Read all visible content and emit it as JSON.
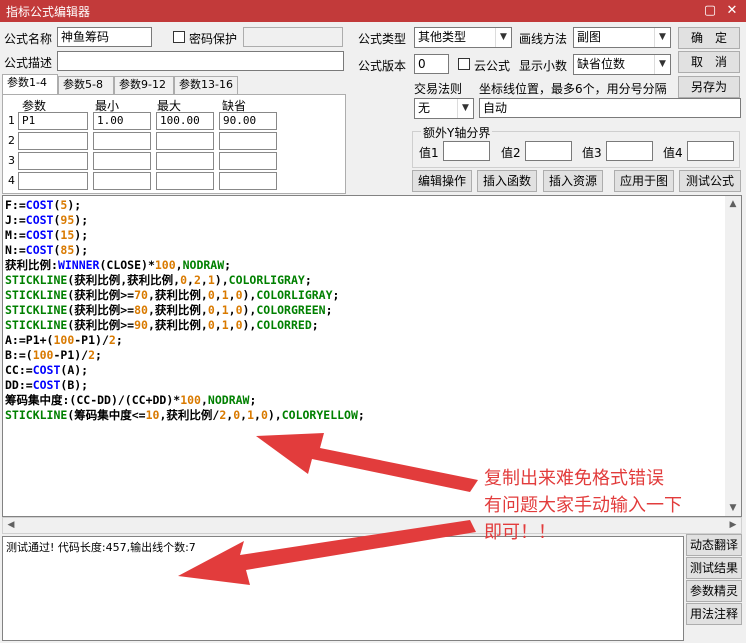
{
  "window": {
    "title": "指标公式编辑器",
    "close_glyph": "✕",
    "restore_glyph": "▢"
  },
  "form": {
    "name_label": "公式名称",
    "name_value": "神鱼筹码",
    "password_label": "密码保护",
    "password_value": "",
    "desc_label": "公式描述",
    "desc_value": "",
    "type_label": "公式类型",
    "type_value": "其他类型",
    "draw_label": "画线方法",
    "draw_value": "副图",
    "version_label": "公式版本",
    "version_value": "0",
    "cloud_label": "云公式",
    "decimal_label": "显示小数",
    "decimal_value": "缺省位数",
    "trade_label": "交易法则",
    "trade_value": "无",
    "coord_label": "坐标线位置，最多6个，用分号分隔",
    "coord_value": "自动",
    "yaxis_title": "额外Y轴分界",
    "yaxis_values": [
      {
        "label": "值1",
        "value": ""
      },
      {
        "label": "值2",
        "value": ""
      },
      {
        "label": "值3",
        "value": ""
      },
      {
        "label": "值4",
        "value": ""
      }
    ]
  },
  "buttons": {
    "ok": "确　定",
    "cancel": "取　消",
    "save_as": "另存为",
    "edit_ops": "编辑操作",
    "insert_func": "插入函数",
    "insert_res": "插入资源",
    "apply_chart": "应用于图",
    "test_formula": "测试公式",
    "dyn_translate": "动态翻译",
    "test_result": "测试结果",
    "param_tune": "参数精灵",
    "usage_note": "用法注释"
  },
  "tabs": [
    "参数1-4",
    "参数5-8",
    "参数9-12",
    "参数13-16"
  ],
  "params": {
    "headers": [
      "参数",
      "最小",
      "最大",
      "缺省"
    ],
    "rows": [
      {
        "num": "1",
        "cells": [
          "P1",
          "1.00",
          "100.00",
          "90.00"
        ]
      },
      {
        "num": "2",
        "cells": [
          "",
          "",
          "",
          ""
        ]
      },
      {
        "num": "3",
        "cells": [
          "",
          "",
          "",
          ""
        ]
      },
      {
        "num": "4",
        "cells": [
          "",
          "",
          "",
          ""
        ]
      }
    ]
  },
  "colors": {
    "titlebar": "#c23a3a",
    "code_ident": "#000000",
    "code_func": "#0000ff",
    "code_number": "#d97a00",
    "code_color": "#008000",
    "code_keyword": "#008000",
    "annotation": "#e23c3c"
  },
  "code_lines": [
    [
      {
        "t": "F:=",
        "c": "ident"
      },
      {
        "t": "COST",
        "c": "func"
      },
      {
        "t": "(",
        "c": "ident"
      },
      {
        "t": "5",
        "c": "number"
      },
      {
        "t": ");",
        "c": "ident"
      }
    ],
    [
      {
        "t": "J:=",
        "c": "ident"
      },
      {
        "t": "COST",
        "c": "func"
      },
      {
        "t": "(",
        "c": "ident"
      },
      {
        "t": "95",
        "c": "number"
      },
      {
        "t": ");",
        "c": "ident"
      }
    ],
    [
      {
        "t": "M:=",
        "c": "ident"
      },
      {
        "t": "COST",
        "c": "func"
      },
      {
        "t": "(",
        "c": "ident"
      },
      {
        "t": "15",
        "c": "number"
      },
      {
        "t": ");",
        "c": "ident"
      }
    ],
    [
      {
        "t": "N:=",
        "c": "ident"
      },
      {
        "t": "COST",
        "c": "func"
      },
      {
        "t": "(",
        "c": "ident"
      },
      {
        "t": "85",
        "c": "number"
      },
      {
        "t": ");",
        "c": "ident"
      }
    ],
    [
      {
        "t": "获利比例:",
        "c": "ident"
      },
      {
        "t": "WINNER",
        "c": "func"
      },
      {
        "t": "(CLOSE)*",
        "c": "ident"
      },
      {
        "t": "100",
        "c": "number"
      },
      {
        "t": ",",
        "c": "ident"
      },
      {
        "t": "NODRAW",
        "c": "keyword"
      },
      {
        "t": ";",
        "c": "ident"
      }
    ],
    [
      {
        "t": "STICKLINE",
        "c": "keyword"
      },
      {
        "t": "(获利比例,获利比例,",
        "c": "ident"
      },
      {
        "t": "0",
        "c": "number"
      },
      {
        "t": ",",
        "c": "ident"
      },
      {
        "t": "2",
        "c": "number"
      },
      {
        "t": ",",
        "c": "ident"
      },
      {
        "t": "1",
        "c": "number"
      },
      {
        "t": "),",
        "c": "ident"
      },
      {
        "t": "COLORLIGRAY",
        "c": "color"
      },
      {
        "t": ";",
        "c": "ident"
      }
    ],
    [
      {
        "t": "STICKLINE",
        "c": "keyword"
      },
      {
        "t": "(获利比例>=",
        "c": "ident"
      },
      {
        "t": "70",
        "c": "number"
      },
      {
        "t": ",获利比例,",
        "c": "ident"
      },
      {
        "t": "0",
        "c": "number"
      },
      {
        "t": ",",
        "c": "ident"
      },
      {
        "t": "1",
        "c": "number"
      },
      {
        "t": ",",
        "c": "ident"
      },
      {
        "t": "0",
        "c": "number"
      },
      {
        "t": "),",
        "c": "ident"
      },
      {
        "t": "COLORLIGRAY",
        "c": "color"
      },
      {
        "t": ";",
        "c": "ident"
      }
    ],
    [
      {
        "t": "STICKLINE",
        "c": "keyword"
      },
      {
        "t": "(获利比例>=",
        "c": "ident"
      },
      {
        "t": "80",
        "c": "number"
      },
      {
        "t": ",获利比例,",
        "c": "ident"
      },
      {
        "t": "0",
        "c": "number"
      },
      {
        "t": ",",
        "c": "ident"
      },
      {
        "t": "1",
        "c": "number"
      },
      {
        "t": ",",
        "c": "ident"
      },
      {
        "t": "0",
        "c": "number"
      },
      {
        "t": "),",
        "c": "ident"
      },
      {
        "t": "COLORGREEN",
        "c": "color"
      },
      {
        "t": ";",
        "c": "ident"
      }
    ],
    [
      {
        "t": "STICKLINE",
        "c": "keyword"
      },
      {
        "t": "(获利比例>=",
        "c": "ident"
      },
      {
        "t": "90",
        "c": "number"
      },
      {
        "t": ",获利比例,",
        "c": "ident"
      },
      {
        "t": "0",
        "c": "number"
      },
      {
        "t": ",",
        "c": "ident"
      },
      {
        "t": "1",
        "c": "number"
      },
      {
        "t": ",",
        "c": "ident"
      },
      {
        "t": "0",
        "c": "number"
      },
      {
        "t": "),",
        "c": "ident"
      },
      {
        "t": "COLORRED",
        "c": "color"
      },
      {
        "t": ";",
        "c": "ident"
      }
    ],
    [
      {
        "t": "A:=P1+(",
        "c": "ident"
      },
      {
        "t": "100",
        "c": "number"
      },
      {
        "t": "-P1)/",
        "c": "ident"
      },
      {
        "t": "2",
        "c": "number"
      },
      {
        "t": ";",
        "c": "ident"
      }
    ],
    [
      {
        "t": "B:=(",
        "c": "ident"
      },
      {
        "t": "100",
        "c": "number"
      },
      {
        "t": "-P1)/",
        "c": "ident"
      },
      {
        "t": "2",
        "c": "number"
      },
      {
        "t": ";",
        "c": "ident"
      }
    ],
    [
      {
        "t": "CC:=",
        "c": "ident"
      },
      {
        "t": "COST",
        "c": "func"
      },
      {
        "t": "(A);",
        "c": "ident"
      }
    ],
    [
      {
        "t": "DD:=",
        "c": "ident"
      },
      {
        "t": "COST",
        "c": "func"
      },
      {
        "t": "(B);",
        "c": "ident"
      }
    ],
    [
      {
        "t": "筹码集中度:(CC-DD)/(CC+DD)*",
        "c": "ident"
      },
      {
        "t": "100",
        "c": "number"
      },
      {
        "t": ",",
        "c": "ident"
      },
      {
        "t": "NODRAW",
        "c": "keyword"
      },
      {
        "t": ";",
        "c": "ident"
      }
    ],
    [
      {
        "t": "STICKLINE",
        "c": "keyword"
      },
      {
        "t": "(筹码集中度<=",
        "c": "ident"
      },
      {
        "t": "10",
        "c": "number"
      },
      {
        "t": ",获利比例/",
        "c": "ident"
      },
      {
        "t": "2",
        "c": "number"
      },
      {
        "t": ",",
        "c": "ident"
      },
      {
        "t": "0",
        "c": "number"
      },
      {
        "t": ",",
        "c": "ident"
      },
      {
        "t": "1",
        "c": "number"
      },
      {
        "t": ",",
        "c": "ident"
      },
      {
        "t": "0",
        "c": "number"
      },
      {
        "t": "),",
        "c": "ident"
      },
      {
        "t": "COLORYELLOW",
        "c": "color"
      },
      {
        "t": ";",
        "c": "ident"
      }
    ]
  ],
  "status": "测试通过! 代码长度:457,输出线个数:7",
  "annotation": {
    "line1": "复制出来难免格式错误",
    "line2": "有问题大家手动输入一下",
    "line3": "即可！！"
  }
}
